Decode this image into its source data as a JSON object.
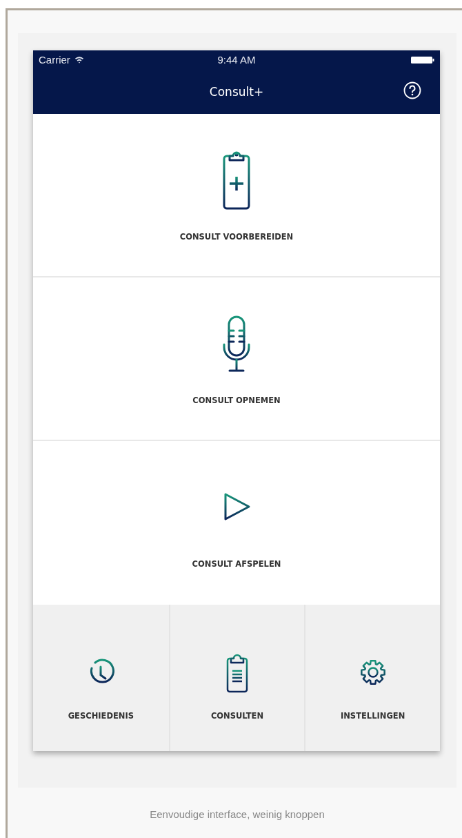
{
  "status_bar": {
    "carrier": "Carrier",
    "time": "9:44 AM"
  },
  "nav_bar": {
    "title": "Consult+"
  },
  "actions": [
    {
      "label": "CONSULT VOORBEREIDEN",
      "kind": "clipboard-plus"
    },
    {
      "label": "CONSULT OPNEMEN",
      "kind": "microphone"
    },
    {
      "label": "CONSULT AFSPELEN",
      "kind": "play"
    }
  ],
  "bottom_menu": [
    {
      "label": "GESCHIEDENIS",
      "kind": "clock"
    },
    {
      "label": "CONSULTEN",
      "kind": "clipboard-list"
    },
    {
      "label": "INSTELLINGEN",
      "kind": "gear"
    }
  ],
  "caption": "Eenvoudige interface, weinig knoppen"
}
